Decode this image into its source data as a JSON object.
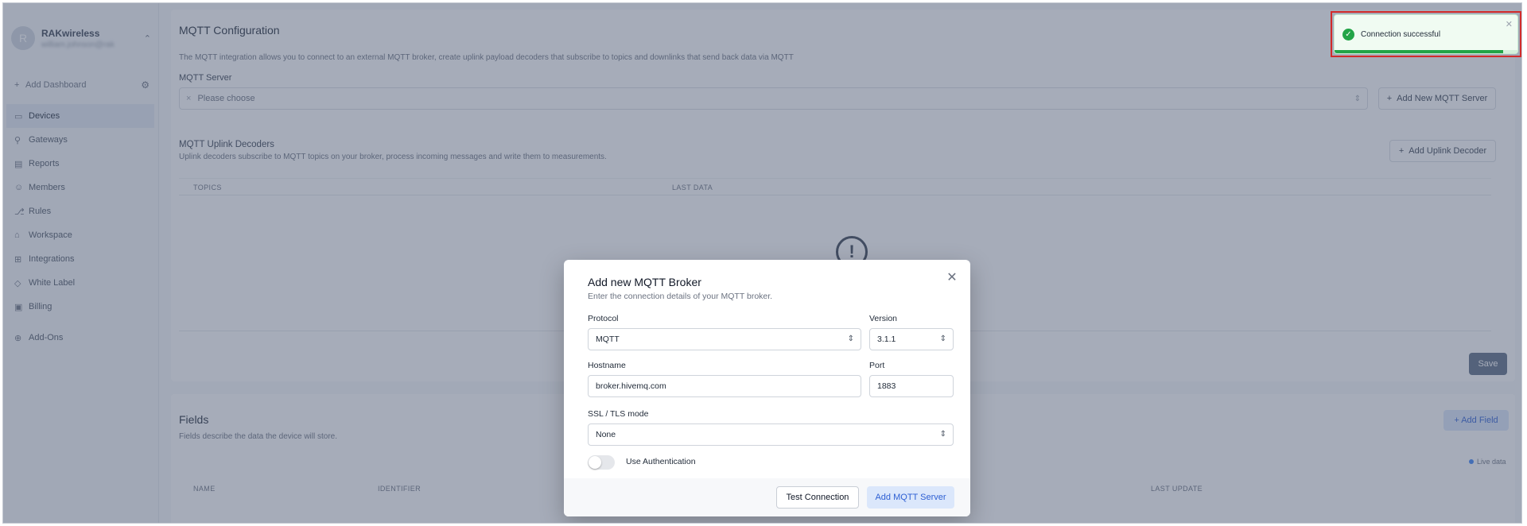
{
  "sidebar": {
    "org_initial": "R",
    "org_name": "RAKwireless",
    "org_sub": "william.johnson@rak",
    "add_dashboard": "Add Dashboard",
    "items": [
      {
        "label": "Devices",
        "icon": "devices-icon",
        "glyph": "▭",
        "active": true
      },
      {
        "label": "Gateways",
        "icon": "gateway-icon",
        "glyph": "⚲",
        "active": false
      },
      {
        "label": "Reports",
        "icon": "report-icon",
        "glyph": "▤",
        "active": false
      },
      {
        "label": "Members",
        "icon": "members-icon",
        "glyph": "☺",
        "active": false
      },
      {
        "label": "Rules",
        "icon": "rules-icon",
        "glyph": "⎇",
        "active": false
      },
      {
        "label": "Workspace",
        "icon": "workspace-icon",
        "glyph": "⌂",
        "active": false
      },
      {
        "label": "Integrations",
        "icon": "integrations-icon",
        "glyph": "⊞",
        "active": false
      },
      {
        "label": "White Label",
        "icon": "white-label-icon",
        "glyph": "◇",
        "active": false
      },
      {
        "label": "Billing",
        "icon": "billing-icon",
        "glyph": "▣",
        "active": false
      }
    ],
    "addons": {
      "label": "Add-Ons",
      "icon": "addons-icon",
      "glyph": "⊕"
    }
  },
  "mqtt": {
    "title": "MQTT Configuration",
    "description": "The MQTT integration allows you to connect to an external MQTT broker, create uplink payload decoders that subscribe to topics and downlinks that send back data via MQTT",
    "server_label": "MQTT Server",
    "server_placeholder": "Please choose",
    "add_server_button": "Add New MQTT Server",
    "decoders_title": "MQTT Uplink Decoders",
    "decoders_desc": "Uplink decoders subscribe to MQTT topics on your broker, process incoming messages and write them to measurements.",
    "add_decoder_button": "Add Uplink Decoder",
    "columns": [
      "TOPICS",
      "LAST DATA"
    ],
    "save_button": "Save"
  },
  "fields": {
    "title": "Fields",
    "description": "Fields describe the data the device will store.",
    "add_field_button": "Add Field",
    "live_label": "Live data",
    "columns": [
      "NAME",
      "IDENTIFIER",
      "LAST UPDATE"
    ]
  },
  "modal": {
    "title": "Add new MQTT Broker",
    "subtitle": "Enter the connection details of your MQTT broker.",
    "protocol_label": "Protocol",
    "protocol_value": "MQTT",
    "version_label": "Version",
    "version_value": "3.1.1",
    "hostname_label": "Hostname",
    "hostname_value": "broker.hivemq.com",
    "port_label": "Port",
    "port_value": "1883",
    "ssl_label": "SSL / TLS mode",
    "ssl_value": "None",
    "auth_label": "Use Authentication",
    "auth_enabled": false,
    "test_button": "Test Connection",
    "add_button": "Add MQTT Server"
  },
  "toast": {
    "message": "Connection successful",
    "progress": 0.92,
    "status_color": "#22a447"
  }
}
